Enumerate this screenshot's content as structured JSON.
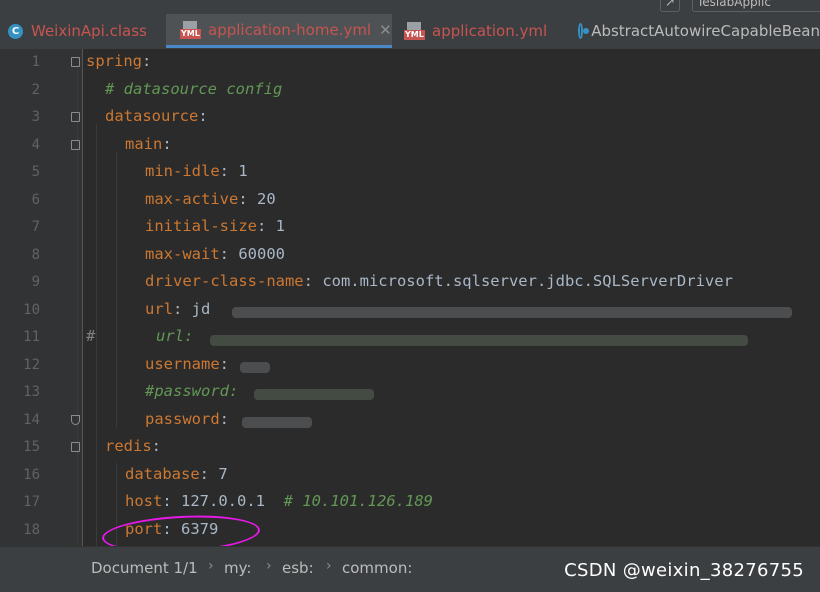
{
  "tabs": [
    {
      "label": "WeixinApi.class",
      "icon": "class-icon",
      "active": false
    },
    {
      "label": "application-home.yml",
      "icon": "yml-icon",
      "active": true
    },
    {
      "label": "application.yml",
      "icon": "yml-icon",
      "active": false
    },
    {
      "label": "AbstractAutowireCapableBean",
      "icon": "abstract-class-icon",
      "active": false
    }
  ],
  "topright_tab": "TeslabApplic",
  "line_numbers": [
    "1",
    "2",
    "3",
    "4",
    "5",
    "6",
    "7",
    "8",
    "9",
    "10",
    "11",
    "12",
    "13",
    "14",
    "15",
    "16",
    "17",
    "18"
  ],
  "code": {
    "l1_key": "spring",
    "l1_colon": ":",
    "l2_comment": "# datasource config",
    "l3_key": "datasource",
    "l3_colon": ":",
    "l4_key": "main",
    "l4_colon": ":",
    "l5_key": "min-idle",
    "l5_sep": ": ",
    "l5_val": "1",
    "l6_key": "max-active",
    "l6_sep": ": ",
    "l6_val": "20",
    "l7_key": "initial-size",
    "l7_sep": ": ",
    "l7_val": "1",
    "l8_key": "max-wait",
    "l8_sep": ": ",
    "l8_val": "60000",
    "l9_key": "driver-class-name",
    "l9_sep": ": ",
    "l9_val": "com.microsoft.sqlserver.jdbc.SQLServerDriver",
    "l10_key": "url",
    "l10_sep": ": ",
    "l10_val": "jd",
    "l11_hash": "#",
    "l11_key": "url",
    "l11_sep": ":",
    "l12_key": "username",
    "l12_sep": ":",
    "l13_comment": "#password:",
    "l14_key": "password",
    "l14_sep": ":",
    "l15_key": "redis",
    "l15_colon": ":",
    "l16_key": "database",
    "l16_sep": ": ",
    "l16_val": "7",
    "l17_key": "host",
    "l17_sep": ": ",
    "l17_val": "127.0.0.1",
    "l17_comment": "# 10.101.126.189",
    "l18_key": "port",
    "l18_sep": ": ",
    "l18_val": "6379"
  },
  "breadcrumb": [
    "Document 1/1",
    "my:",
    "esb:",
    "common:"
  ],
  "watermark": "CSDN @weixin_38276755",
  "colors": {
    "background": "#2b2b2b",
    "key": "#cc7832",
    "comment": "#629755",
    "value": "#a9b7c6",
    "annotation_circle": "#e619e6"
  }
}
